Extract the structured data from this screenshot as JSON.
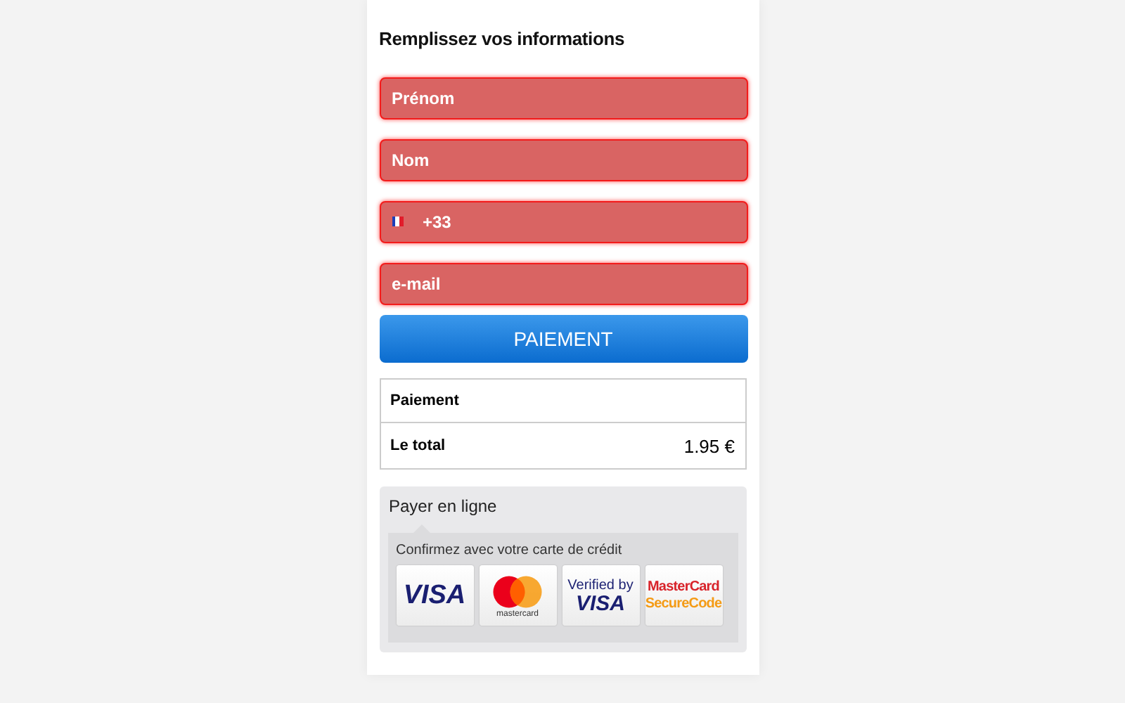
{
  "form": {
    "title": "Remplissez vos informations",
    "fields": [
      {
        "kind": "text",
        "placeholder": "Prénom",
        "invalid": true
      },
      {
        "kind": "text",
        "placeholder": "Nom",
        "invalid": true
      },
      {
        "kind": "phone",
        "value": "+33",
        "invalid": true
      },
      {
        "kind": "text",
        "placeholder": "e-mail",
        "invalid": true
      }
    ],
    "submit": "PAIEMENT"
  },
  "summary": {
    "rows": [
      {
        "label": "Paiement"
      },
      {
        "label": "Le total",
        "value": "1.95 €"
      }
    ]
  },
  "payment": {
    "title": "Payer en ligne",
    "prompt": "Confirmez avec votre carte de crédit",
    "logos": [
      {
        "kind": "visa",
        "lines": [
          "VISA"
        ]
      },
      {
        "kind": "mastercard",
        "lines": [
          "mastercard"
        ]
      },
      {
        "kind": "verified",
        "lines": [
          "Verified by",
          "VISA"
        ]
      },
      {
        "kind": "securecode",
        "lines": [
          "MasterCard",
          "SecureCode"
        ]
      }
    ]
  }
}
